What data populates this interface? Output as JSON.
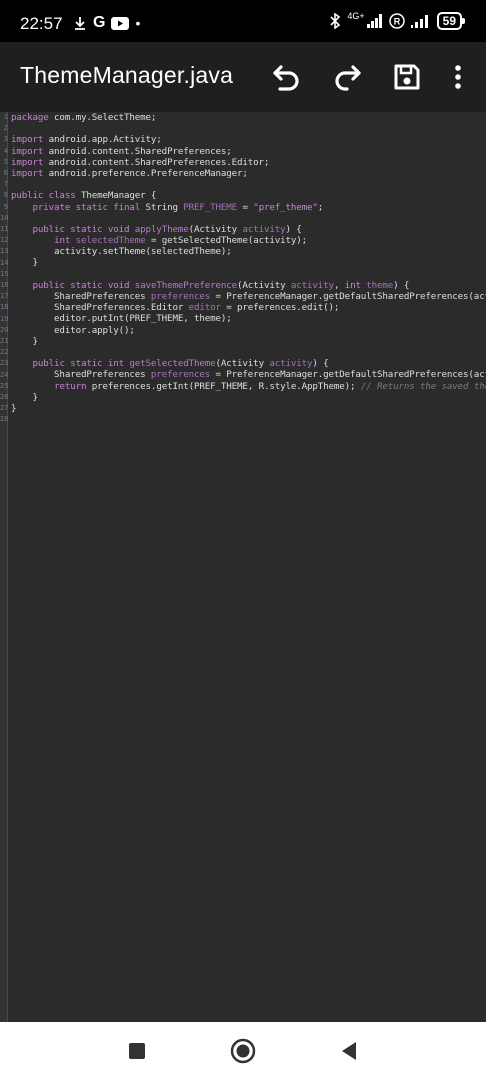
{
  "status_bar": {
    "time": "22:57",
    "left_icons": [
      "download-icon",
      "google-icon",
      "youtube-icon",
      "dot-icon"
    ],
    "network": "4G+",
    "battery": "59"
  },
  "app_bar": {
    "title": "ThemeManager.java",
    "actions": [
      "undo-icon",
      "redo-icon",
      "save-icon",
      "more-icon"
    ]
  },
  "editor": {
    "gutter": [
      "1",
      "2",
      "3",
      "4",
      "5",
      "6",
      "7",
      "8",
      "9",
      "10",
      "11",
      "12",
      "13",
      "14",
      "15",
      "16",
      "17",
      "18",
      "19",
      "20",
      "21",
      "22",
      "23",
      "24",
      "25",
      "26",
      "27",
      "28"
    ],
    "lines": [
      [
        {
          "t": "kw",
          "v": "package"
        },
        {
          "t": "txt",
          "v": " com.my.SelectTheme;"
        }
      ],
      [],
      [
        {
          "t": "kw",
          "v": "import"
        },
        {
          "t": "txt",
          "v": " android.app.Activity;"
        }
      ],
      [
        {
          "t": "kw",
          "v": "import"
        },
        {
          "t": "txt",
          "v": " android.content.SharedPreferences;"
        }
      ],
      [
        {
          "t": "kw",
          "v": "import"
        },
        {
          "t": "txt",
          "v": " android.content.SharedPreferences.Editor;"
        }
      ],
      [
        {
          "t": "kw",
          "v": "import"
        },
        {
          "t": "txt",
          "v": " android.preference.PreferenceManager;"
        }
      ],
      [],
      [
        {
          "t": "kw",
          "v": "public class"
        },
        {
          "t": "txt",
          "v": " ThemeManager {"
        }
      ],
      [
        {
          "t": "txt",
          "v": "    "
        },
        {
          "t": "kw",
          "v": "private static final"
        },
        {
          "t": "txt",
          "v": " String "
        },
        {
          "t": "var",
          "v": "PREF_THEME"
        },
        {
          "t": "txt",
          "v": " = "
        },
        {
          "t": "str",
          "v": "\"pref_theme\""
        },
        {
          "t": "txt",
          "v": ";"
        }
      ],
      [],
      [
        {
          "t": "txt",
          "v": "    "
        },
        {
          "t": "kw",
          "v": "public static void"
        },
        {
          "t": "txt",
          "v": " "
        },
        {
          "t": "fn",
          "v": "applyTheme"
        },
        {
          "t": "txt",
          "v": "(Activity "
        },
        {
          "t": "var",
          "v": "activity"
        },
        {
          "t": "txt",
          "v": ") {"
        }
      ],
      [
        {
          "t": "txt",
          "v": "        "
        },
        {
          "t": "kw",
          "v": "int"
        },
        {
          "t": "txt",
          "v": " "
        },
        {
          "t": "var",
          "v": "selectedTheme"
        },
        {
          "t": "txt",
          "v": " = getSelectedTheme(activity);"
        }
      ],
      [
        {
          "t": "txt",
          "v": "        activity.setTheme(selectedTheme);"
        }
      ],
      [
        {
          "t": "txt",
          "v": "    }"
        }
      ],
      [],
      [
        {
          "t": "txt",
          "v": "    "
        },
        {
          "t": "kw",
          "v": "public static void"
        },
        {
          "t": "txt",
          "v": " "
        },
        {
          "t": "fn",
          "v": "saveThemePreference"
        },
        {
          "t": "txt",
          "v": "(Activity "
        },
        {
          "t": "var",
          "v": "activity"
        },
        {
          "t": "txt",
          "v": ", "
        },
        {
          "t": "kw",
          "v": "int"
        },
        {
          "t": "txt",
          "v": " "
        },
        {
          "t": "var",
          "v": "theme"
        },
        {
          "t": "txt",
          "v": ") {"
        }
      ],
      [
        {
          "t": "txt",
          "v": "        SharedPreferences "
        },
        {
          "t": "var",
          "v": "preferences"
        },
        {
          "t": "txt",
          "v": " = PreferenceManager.getDefaultSharedPreferences(activity);"
        }
      ],
      [
        {
          "t": "txt",
          "v": "        SharedPreferences.Editor "
        },
        {
          "t": "var",
          "v": "editor"
        },
        {
          "t": "txt",
          "v": " = preferences.edit();"
        }
      ],
      [
        {
          "t": "txt",
          "v": "        editor.putInt(PREF_THEME, theme);"
        }
      ],
      [
        {
          "t": "txt",
          "v": "        editor.apply();"
        }
      ],
      [
        {
          "t": "txt",
          "v": "    }"
        }
      ],
      [],
      [
        {
          "t": "txt",
          "v": "    "
        },
        {
          "t": "kw",
          "v": "public static int"
        },
        {
          "t": "txt",
          "v": " "
        },
        {
          "t": "fn",
          "v": "getSelectedTheme"
        },
        {
          "t": "txt",
          "v": "(Activity "
        },
        {
          "t": "var",
          "v": "activity"
        },
        {
          "t": "txt",
          "v": ") {"
        }
      ],
      [
        {
          "t": "txt",
          "v": "        SharedPreferences "
        },
        {
          "t": "var",
          "v": "preferences"
        },
        {
          "t": "txt",
          "v": " = PreferenceManager.getDefaultSharedPreferences(activity);"
        }
      ],
      [
        {
          "t": "txt",
          "v": "        "
        },
        {
          "t": "kw",
          "v": "return"
        },
        {
          "t": "txt",
          "v": " preferences.getInt(PREF_THEME, R.style.AppTheme); "
        },
        {
          "t": "cmt",
          "v": "// Returns the saved theme"
        }
      ],
      [
        {
          "t": "txt",
          "v": "    }"
        }
      ],
      [
        {
          "t": "txt",
          "v": "}"
        }
      ],
      []
    ]
  },
  "nav_bar": {
    "buttons": [
      "recents-icon",
      "home-icon",
      "back-icon"
    ]
  }
}
